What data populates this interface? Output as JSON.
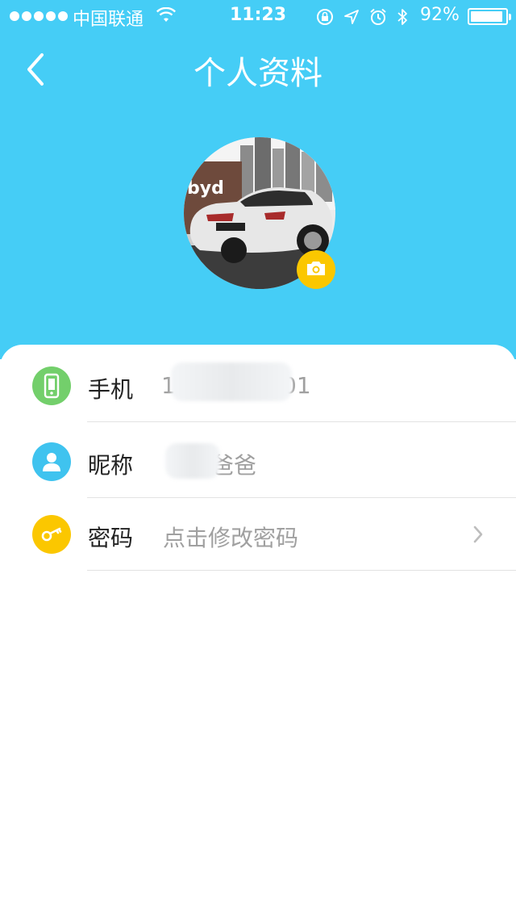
{
  "status_bar": {
    "carrier": "中国联通",
    "time": "11:23",
    "battery_percent": "92%",
    "battery_level": 0.92,
    "icons": [
      "signal-dots",
      "wifi-icon",
      "rotation-lock-icon",
      "location-icon",
      "alarm-icon",
      "bluetooth-icon",
      "battery-icon"
    ]
  },
  "nav": {
    "title": "个人资料",
    "back_icon": "chevron-left-icon"
  },
  "avatar": {
    "camera_icon": "camera-icon"
  },
  "colors": {
    "header_bg": "#45cdf6",
    "phone_icon": "#73cf6b",
    "nickname_icon": "#3fc3ef",
    "password_icon": "#fbc700",
    "camera_badge": "#fbc700"
  },
  "profile": {
    "rows": [
      {
        "label": "手机",
        "value_visible_start": "1",
        "value_visible_end": "01",
        "icon": "phone-icon"
      },
      {
        "label": "昵称",
        "value_visible_end": "爸爸",
        "icon": "user-icon"
      },
      {
        "label": "密码",
        "value": "点击修改密码",
        "icon": "key-icon",
        "chevron": "chevron-right-icon"
      }
    ]
  }
}
